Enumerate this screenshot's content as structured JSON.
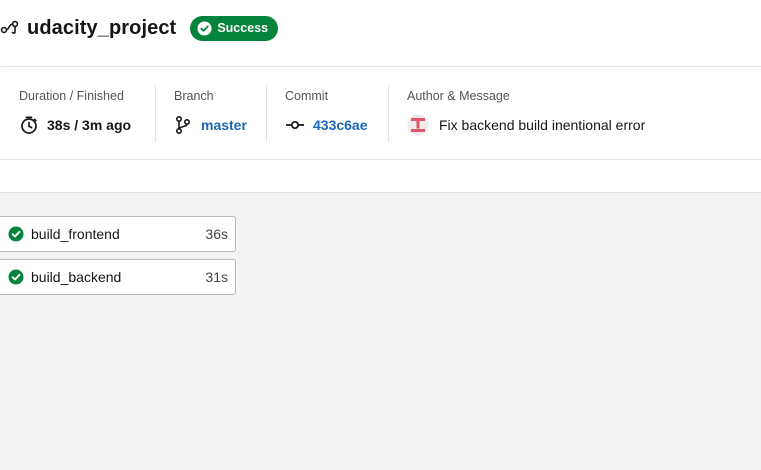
{
  "header": {
    "project_name": "udacity_project",
    "status_label": "Success",
    "status_color": "#04843a"
  },
  "summary": {
    "duration": {
      "label": "Duration / Finished",
      "value": "38s / 3m ago",
      "icon": "timer-icon"
    },
    "branch": {
      "label": "Branch",
      "value": "master",
      "icon": "branch-icon"
    },
    "commit": {
      "label": "Commit",
      "value": "433c6ae",
      "icon": "commit-icon"
    },
    "author": {
      "label": "Author & Message",
      "message": "Fix backend build inentional error",
      "icon": "avatar"
    }
  },
  "jobs": [
    {
      "name": "build_frontend",
      "duration": "36s",
      "status": "success"
    },
    {
      "name": "build_backend",
      "duration": "31s",
      "status": "success"
    }
  ],
  "colors": {
    "link": "#1b69b6",
    "success": "#04843a"
  }
}
